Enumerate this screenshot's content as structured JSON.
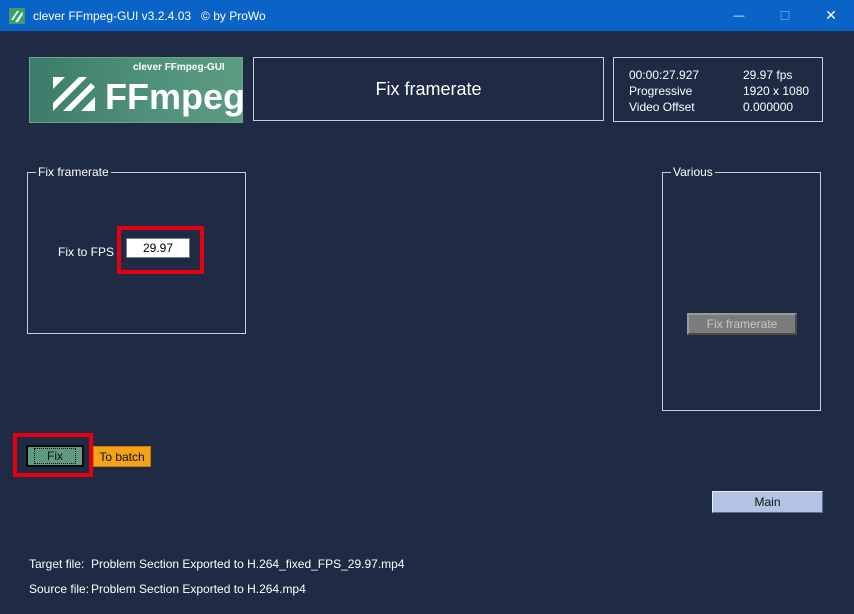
{
  "window": {
    "title": "clever FFmpeg-GUI v3.2.4.03   © by ProWo",
    "minimize_glyph": "—",
    "maximize_glyph": "☐",
    "close_glyph": "✕"
  },
  "logo": {
    "subtitle": "clever FFmpeg-GUI",
    "name": "FFmpeg"
  },
  "header": {
    "title": "Fix framerate"
  },
  "info": {
    "duration": "00:00:27.927",
    "fps": "29.97 fps",
    "scan_label": "Progressive",
    "resolution": "1920 x 1080",
    "offset_label": "Video Offset",
    "offset_value": "0.000000"
  },
  "fix_group": {
    "legend": "Fix framerate",
    "fps_label": "Fix to FPS",
    "fps_value": "29.97"
  },
  "various_group": {
    "legend": "Various",
    "fix_framerate_button": "Fix framerate"
  },
  "actions": {
    "fix_label": "Fix",
    "batch_label": "To batch",
    "main_label": "Main"
  },
  "files": {
    "target_label": "Target file:",
    "target_value": "Problem Section Exported to H.264_fixed_FPS_29.97.mp4",
    "source_label": "Source file:",
    "source_value": "Problem Section Exported to H.264.mp4"
  },
  "colors": {
    "titlebar": "#0a64c8",
    "background": "#1f2a44",
    "highlight": "#e6000f",
    "fix_button": "#5f9a82",
    "batch_button": "#f5a21b",
    "main_button": "#b2c3e4"
  },
  "icons": [
    "app-icon",
    "minimize-icon",
    "maximize-icon",
    "close-icon",
    "ffmpeg-logo-icon"
  ]
}
